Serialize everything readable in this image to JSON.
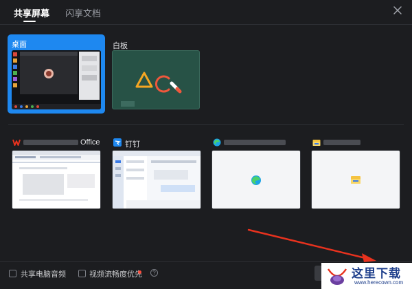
{
  "tabs": [
    {
      "label": "共享屏幕",
      "active": true
    },
    {
      "label": "闪享文档",
      "active": false
    }
  ],
  "close_icon": "close-icon",
  "screens": [
    {
      "label": "桌面",
      "selected": true
    },
    {
      "label": "白板",
      "selected": false
    }
  ],
  "windows": [
    {
      "label": "Office",
      "icon": "wps-office-icon",
      "label_blurred_prefix": true
    },
    {
      "label": "钉钉",
      "icon": "dingtalk-icon",
      "label_blurred_prefix": false
    },
    {
      "label": "",
      "icon": "edge-browser-icon",
      "label_blurred_prefix": true
    },
    {
      "label": "",
      "icon": "file-explorer-icon",
      "label_blurred_prefix": true
    }
  ],
  "options": {
    "share_audio": {
      "label": "共享电脑音频",
      "checked": false
    },
    "smooth_video": {
      "label": "视频流畅度优先",
      "checked": false,
      "badge": "new-dot"
    }
  },
  "help_icon": "?",
  "watermark": {
    "text": "这里下载",
    "url": "www.herecown.com"
  },
  "colors": {
    "accent": "#1e88f0",
    "background": "#1c1d20",
    "whiteboard": "#275246",
    "arrow": "#e8321e"
  }
}
